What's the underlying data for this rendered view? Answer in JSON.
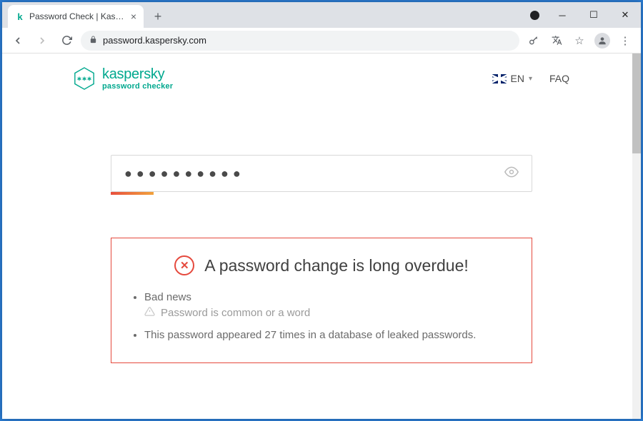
{
  "browser": {
    "tab_title": "Password Check | Kaspers",
    "url": "password.kaspersky.com"
  },
  "header": {
    "brand": "kaspersky",
    "subbrand": "password checker",
    "lang_label": "EN",
    "faq_label": "FAQ"
  },
  "password_input": {
    "masked_value": "●●●●●●●●●●"
  },
  "alert": {
    "title": "A password change is long overdue!",
    "bullets": [
      "Bad news",
      "This password appeared 27 times in a database of leaked passwords."
    ],
    "sub_reason": "Password is common or a word"
  }
}
